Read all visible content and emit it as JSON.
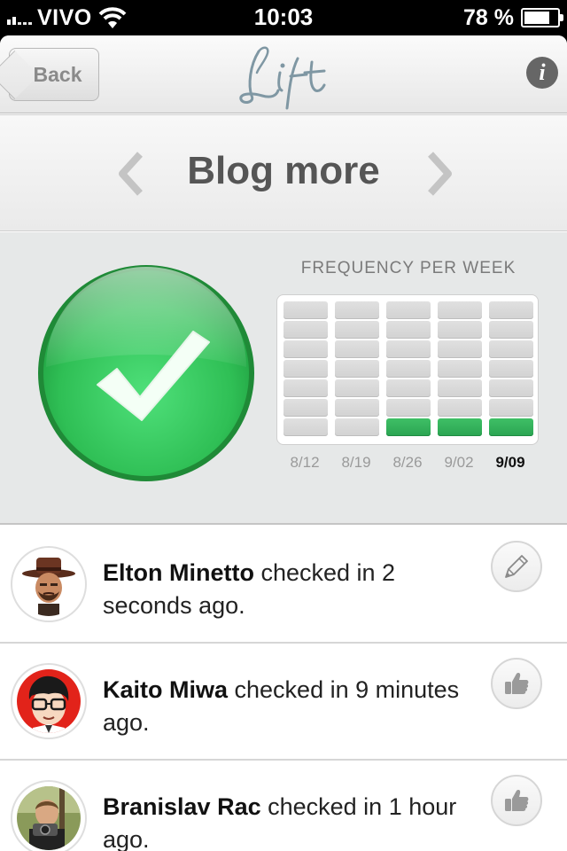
{
  "status_bar": {
    "carrier": "VIVO",
    "time": "10:03",
    "battery_percent": "78 %",
    "battery_level": 0.78
  },
  "navbar": {
    "back_label": "Back",
    "logo_text": "Lift",
    "info_icon": "info-icon"
  },
  "goal": {
    "title": "Blog more"
  },
  "frequency": {
    "label": "FREQUENCY PER WEEK"
  },
  "chart_data": {
    "type": "bar",
    "title": "FREQUENCY PER WEEK",
    "categories": [
      "8/12",
      "8/19",
      "8/26",
      "9/02",
      "9/09"
    ],
    "values": [
      0,
      0,
      1,
      1,
      1
    ],
    "ylim": [
      0,
      7
    ],
    "current_category": "9/09",
    "colors": {
      "filled": "#2fb159",
      "empty": "#d6d6d6"
    }
  },
  "feed": [
    {
      "name": "Elton Minetto",
      "action": " checked in 2 seconds ago.",
      "button_icon": "pencil-icon"
    },
    {
      "name": "Kaito Miwa",
      "action": " checked in 9 minutes ago.",
      "button_icon": "thumbs-up-icon"
    },
    {
      "name": "Branislav Rac",
      "action": " checked in 1 hour ago.",
      "button_icon": "thumbs-up-icon"
    }
  ],
  "colors": {
    "checkmark_green": "#2fb74f",
    "text_gray": "#555555"
  }
}
